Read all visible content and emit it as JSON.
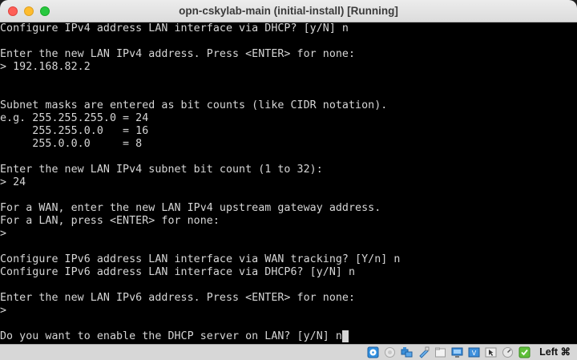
{
  "window": {
    "title": "opn-cskylab-main (initial-install) [Running]"
  },
  "console": {
    "lines": [
      "Configure IPv4 address LAN interface via DHCP? [y/N] n",
      "",
      "Enter the new LAN IPv4 address. Press <ENTER> for none:",
      "> 192.168.82.2",
      "",
      "",
      "Subnet masks are entered as bit counts (like CIDR notation).",
      "e.g. 255.255.255.0 = 24",
      "     255.255.0.0   = 16",
      "     255.0.0.0     = 8",
      "",
      "Enter the new LAN IPv4 subnet bit count (1 to 32):",
      "> 24",
      "",
      "For a WAN, enter the new LAN IPv4 upstream gateway address.",
      "For a LAN, press <ENTER> for none:",
      ">",
      "",
      "Configure IPv6 address LAN interface via WAN tracking? [Y/n] n",
      "Configure IPv6 address LAN interface via DHCP6? [y/N] n",
      "",
      "Enter the new LAN IPv6 address. Press <ENTER> for none:",
      ">",
      "",
      "Do you want to enable the DHCP server on LAN? [y/N] n"
    ],
    "text_color": "#d6d6d6",
    "background_color": "#000000"
  },
  "statusbar": {
    "host_key_label": "Left ⌘",
    "icons": [
      "optical-disc-icon",
      "audio-icon",
      "network-icon",
      "usb-icon",
      "shared-folder-icon",
      "display-icon",
      "video-capture-icon",
      "mouse-integration-icon",
      "cpu-activity-icon",
      "guest-additions-icon"
    ]
  },
  "colors": {
    "close": "#fe5f57",
    "minimize": "#febc2e",
    "maximize": "#28c840"
  }
}
